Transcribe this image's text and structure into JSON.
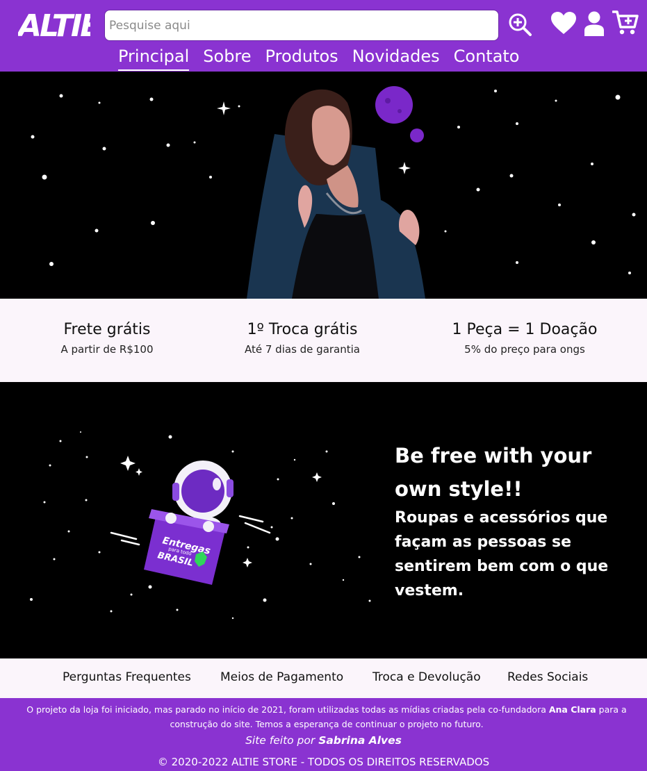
{
  "brand": {
    "logo_text": "ALTIE",
    "accent_color": "#8a33d1"
  },
  "search": {
    "placeholder": "Pesquise aqui",
    "button_icon": "search-plus-icon"
  },
  "header_icons": [
    "heart-icon",
    "user-icon",
    "cart-plus-icon"
  ],
  "nav": {
    "items": [
      {
        "label": "Principal",
        "active": true
      },
      {
        "label": "Sobre"
      },
      {
        "label": "Produtos"
      },
      {
        "label": "Novidades"
      },
      {
        "label": "Contato"
      }
    ]
  },
  "features": [
    {
      "title": "Frete grátis",
      "subtitle": "A partir de R$100"
    },
    {
      "title": "1º Troca grátis",
      "subtitle": "Até 7 dias de garantia"
    },
    {
      "title": "1 Peça = 1 Doação",
      "subtitle": "5% do preço para ongs"
    }
  ],
  "promo": {
    "title": "Be free with your own style!!",
    "text": "Roupas e acessórios que façam as pessoas se sentirem bem com o que vestem.",
    "box_label_top": "Entregas",
    "box_label_mid": "para todo",
    "box_label_bottom": "BRASIL"
  },
  "footer_links": [
    "Perguntas Frequentes",
    "Meios de Pagamento",
    "Troca e Devolução",
    "Redes Sociais"
  ],
  "footer": {
    "note_before": "O projeto da loja foi iniciado, mas parado no início de 2021, foram utilizadas todas as mídias criadas pela co-fundadora ",
    "note_name": "Ana Clara",
    "note_after": " para a construção do site. Temos a esperança de continuar o projeto no futuro.",
    "credit_prefix": "Site feito por ",
    "credit_name": "Sabrina Alves",
    "copyright": "© 2020-2022 ALTIE STORE - TODOS OS DIREITOS RESERVADOS"
  }
}
